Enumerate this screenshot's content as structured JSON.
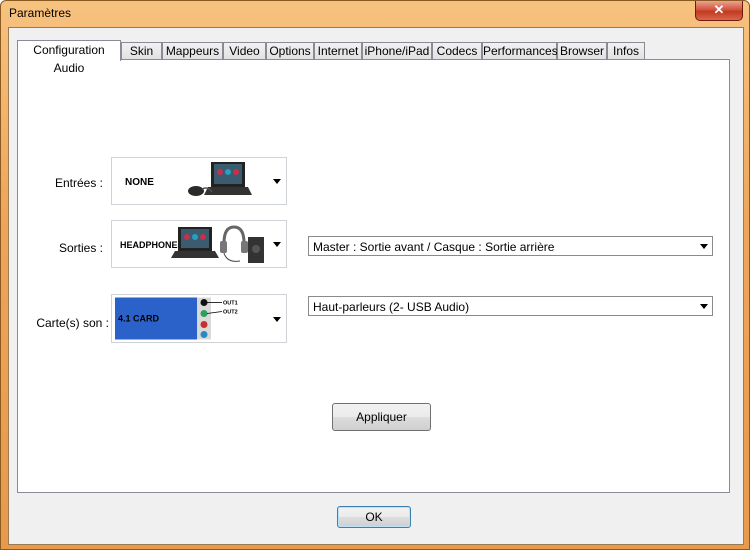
{
  "window": {
    "title": "Paramètres",
    "close_glyph": "✕"
  },
  "tabs": [
    {
      "label": "Configuration Audio",
      "active": true
    },
    {
      "label": "Skin"
    },
    {
      "label": "Mappeurs"
    },
    {
      "label": "Video"
    },
    {
      "label": "Options"
    },
    {
      "label": "Internet"
    },
    {
      "label": "iPhone/iPad"
    },
    {
      "label": "Codecs"
    },
    {
      "label": "Performances"
    },
    {
      "label": "Browser"
    },
    {
      "label": "Infos"
    }
  ],
  "audio": {
    "inputs": {
      "label": "Entrées :",
      "image_text": "NONE"
    },
    "outputs": {
      "label": "Sorties :",
      "image_text": "HEADPHONES",
      "option": "Master : Sortie avant / Casque : Sortie arrière"
    },
    "soundcard": {
      "label": "Carte(s) son :",
      "image_text": "4.1 CARD",
      "out1": "OUT1",
      "out2": "OUT2",
      "option": "Haut-parleurs (2- USB Audio)"
    },
    "apply_label": "Appliquer"
  },
  "footer": {
    "ok_label": "OK"
  },
  "colors": {
    "card_blue": "#2a62c9",
    "frame_orange": "#eea55a"
  }
}
